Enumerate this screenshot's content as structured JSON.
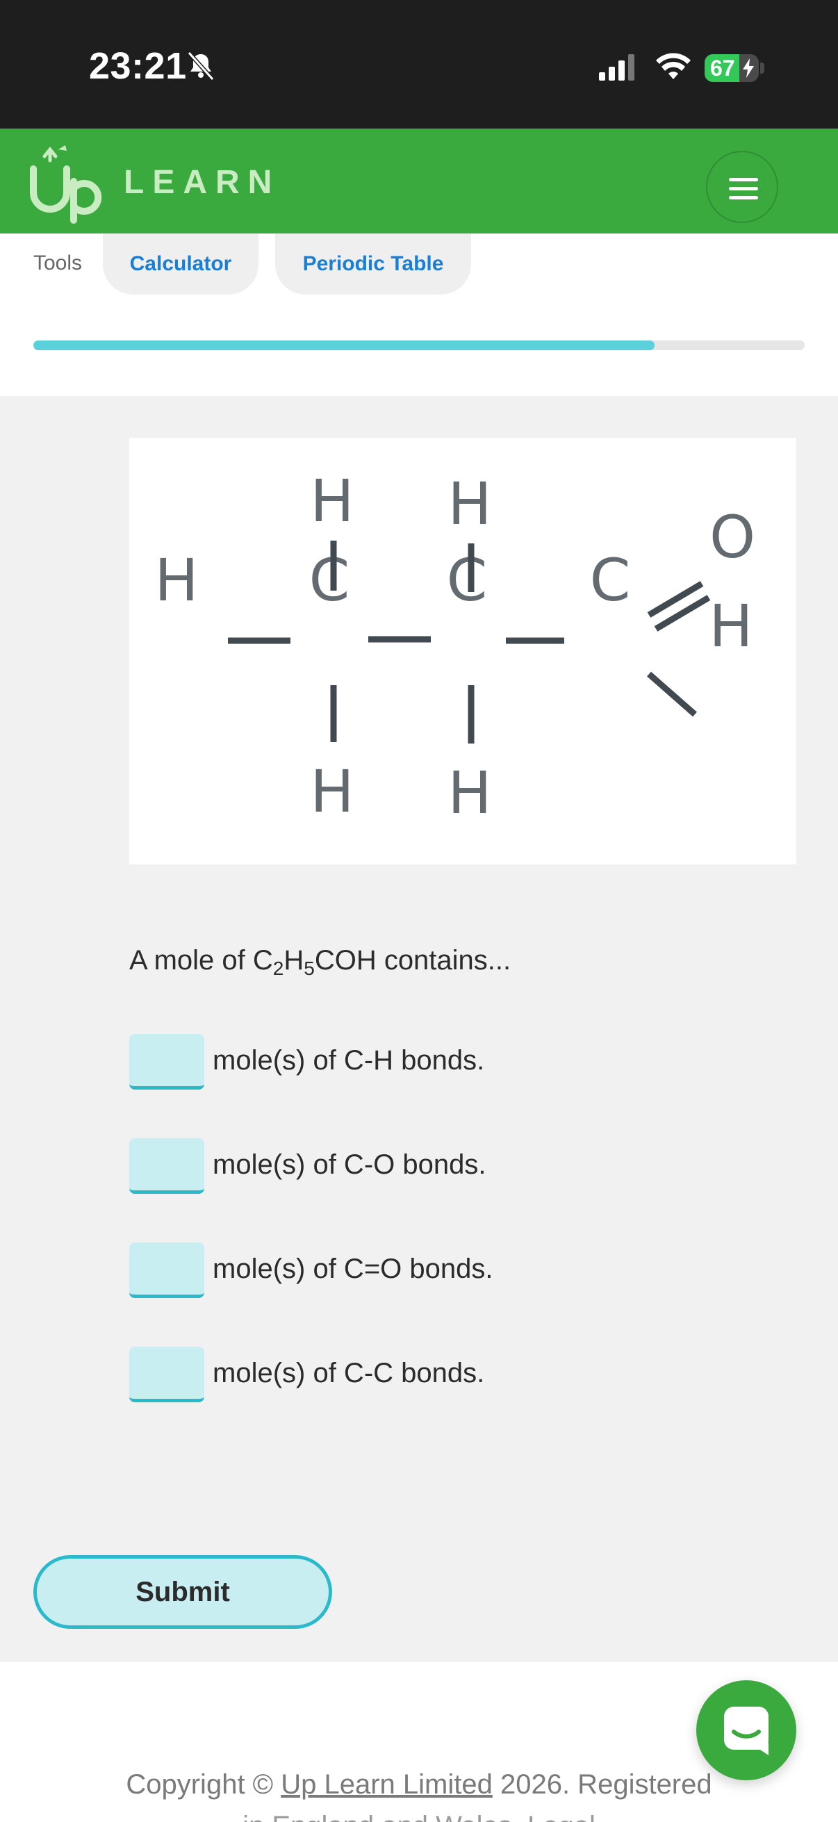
{
  "status_bar": {
    "time": "23:21",
    "battery": "67"
  },
  "header": {
    "logo_text": "LEARN"
  },
  "tools": {
    "label": "Tools",
    "calculator": "Calculator",
    "periodic_table": "Periodic Table"
  },
  "progress": {
    "fraction": 0.805
  },
  "molecule": {
    "atoms": [
      "H",
      "C",
      "C",
      "C",
      "O",
      "H",
      "H",
      "H",
      "H",
      "H"
    ]
  },
  "question": {
    "prefix": "A mole of ",
    "c": "C",
    "c_sub": "2",
    "h": "H",
    "h_sub": "5",
    "suffix": "COH contains..."
  },
  "answers": [
    {
      "label": "mole(s) of C-H bonds."
    },
    {
      "label": "mole(s) of C-O bonds."
    },
    {
      "label": "mole(s) of C=O bonds."
    },
    {
      "label": "mole(s) of C-C bonds."
    }
  ],
  "submit_label": "Submit",
  "footer": {
    "copyright_prefix": "Copyright © ",
    "company": "Up Learn Limited",
    "copyright_suffix": " 2026. Registered",
    "line2": "in England and Wales. Legal"
  },
  "colors": {
    "brand_green": "#3aaa3f",
    "accent_cyan": "#2bbacb",
    "link_blue": "#1a7fd4"
  }
}
